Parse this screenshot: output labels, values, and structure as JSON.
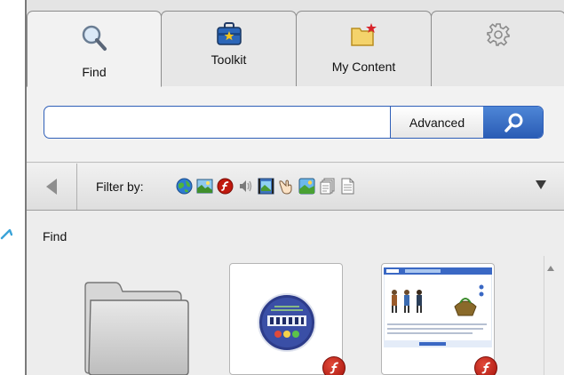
{
  "tabs": [
    {
      "label": "Find",
      "icon": "magnifier-icon",
      "active": true
    },
    {
      "label": "Toolkit",
      "icon": "toolkit-icon",
      "active": false
    },
    {
      "label": "My Content",
      "icon": "folder-star-icon",
      "active": false
    },
    {
      "label": "",
      "icon": "gear-icon",
      "active": false
    }
  ],
  "search": {
    "value": "",
    "placeholder": "",
    "advanced_label": "Advanced"
  },
  "filter": {
    "label": "Filter by:",
    "icons": [
      "globe-icon",
      "image-icon",
      "flash-icon",
      "audio-icon",
      "video-icon",
      "pointer-hand-icon",
      "picture-icon",
      "pages-icon",
      "document-icon"
    ]
  },
  "content": {
    "title": "Find"
  },
  "colors": {
    "accent_blue": "#2f5fb8",
    "flash_red": "#c0190e"
  }
}
